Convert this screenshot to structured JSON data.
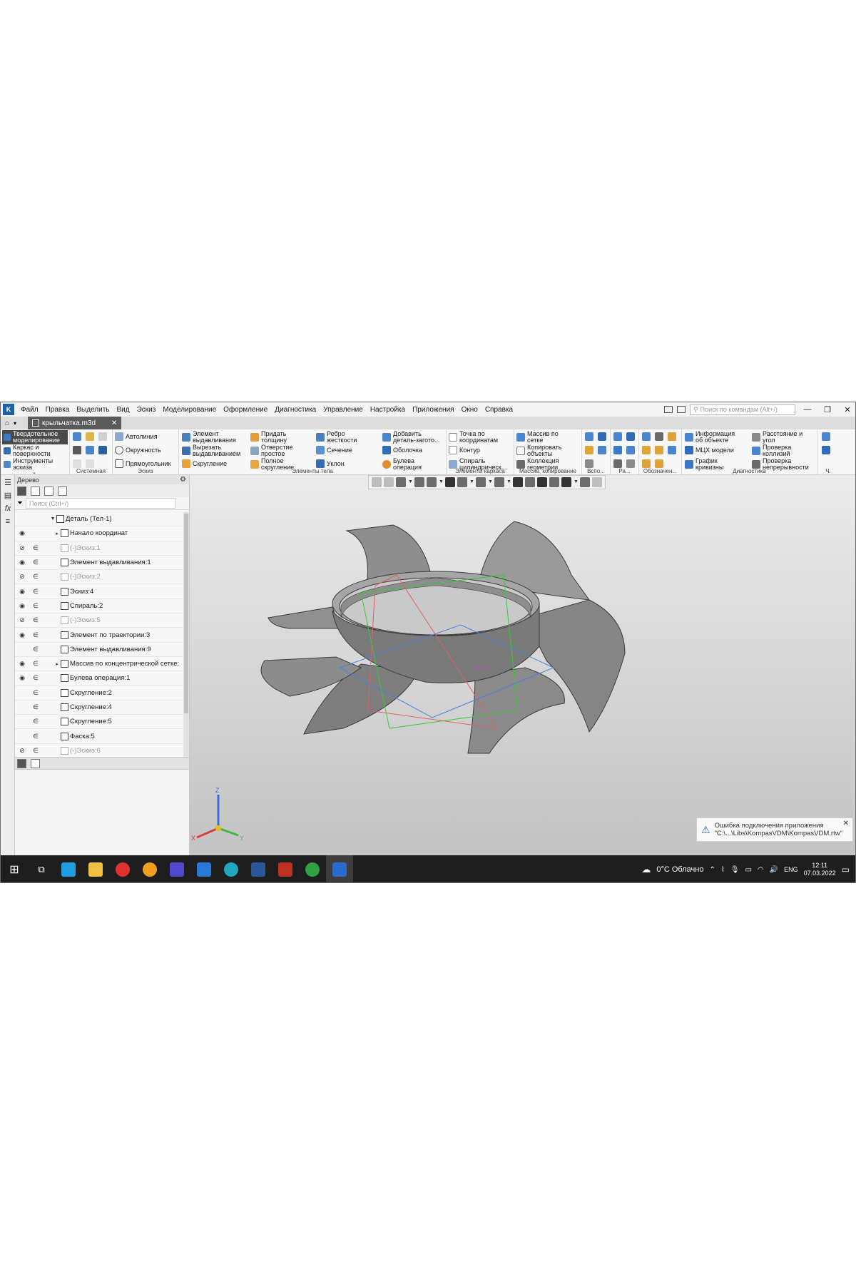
{
  "menu": {
    "items": [
      "Файл",
      "Правка",
      "Выделить",
      "Вид",
      "Эскиз",
      "Моделирование",
      "Оформление",
      "Диагностика",
      "Управление",
      "Настройка",
      "Приложения",
      "Окно",
      "Справка"
    ],
    "search_placeholder": "Поиск по командам (Alt+/)"
  },
  "tabs": {
    "document": "крыльчатка.m3d"
  },
  "ribbon": {
    "modes": [
      "Твердотельное\nмоделирование",
      "Каркас и\nповерхности",
      "Инструменты\nэскиза"
    ],
    "sketch_buttons": [
      "Автолиния",
      "Окружность",
      "Прямоугольник"
    ],
    "body_col1": [
      "Элемент\nвыдавливания",
      "Вырезать\nвыдавливанием",
      "Скругление"
    ],
    "body_col2": [
      "Придать\nтолщину",
      "Отверстие\nпростое",
      "Полное\nскругление"
    ],
    "body_col3": [
      "Ребро\nжесткости",
      "Сечение",
      "Уклон"
    ],
    "body_col4": [
      "Добавить\nдеталь-загото...",
      "Оболочка",
      "Булева\nоперация"
    ],
    "frame_buttons": [
      "Точка по\nкоординатам",
      "Контур",
      "Спираль\nцилиндрическ..."
    ],
    "array_buttons": [
      "Массив по\nсетке",
      "Копировать\nобъекты",
      "Коллекция\nгеометрии"
    ],
    "diag_col1": [
      "Информация\nоб объекте",
      "МЦХ модели",
      "График\nкривизны"
    ],
    "diag_col2": [
      "Расстояние и\nугол",
      "Проверка\nколлизий",
      "Проверка\nнепрерывности"
    ],
    "group_titles": {
      "system": "Системная",
      "sketch": "Эскиз",
      "body": "Элементы тела",
      "frame": "Элементы каркаса",
      "array": "Массив, копирование",
      "aux": "Вспо...",
      "ra": "Ра...",
      "marks": "Обозначен...",
      "diag": "Диагностика",
      "ch": "Ч."
    }
  },
  "tree": {
    "title": "Дерево",
    "search_placeholder": "Поиск (Ctrl+/)",
    "root": "Деталь (Тел-1)",
    "items": [
      {
        "label": "Начало координат",
        "eye": "◉",
        "cap": "",
        "dim": false,
        "expand": true
      },
      {
        "label": "(-)Эскиз:1",
        "eye": "⊘",
        "cap": "∈",
        "dim": true,
        "expand": false
      },
      {
        "label": "Элемент выдавливания:1",
        "eye": "◉",
        "cap": "∈",
        "dim": false,
        "expand": false
      },
      {
        "label": "(-)Эскиз:2",
        "eye": "⊘",
        "cap": "∈",
        "dim": true,
        "expand": false
      },
      {
        "label": "Эскиз:4",
        "eye": "◉",
        "cap": "∈",
        "dim": false,
        "expand": false
      },
      {
        "label": "Спираль:2",
        "eye": "◉",
        "cap": "∈",
        "dim": false,
        "expand": false
      },
      {
        "label": "(-)Эскиз:5",
        "eye": "⊘",
        "cap": "∈",
        "dim": true,
        "expand": false
      },
      {
        "label": "Элемент по траектории:3",
        "eye": "◉",
        "cap": "∈",
        "dim": false,
        "expand": false
      },
      {
        "label": "Элемент выдавливания:9",
        "eye": "",
        "cap": "∈",
        "dim": false,
        "expand": false
      },
      {
        "label": "Массив по концентрической сетке:",
        "eye": "◉",
        "cap": "∈",
        "dim": false,
        "expand": true
      },
      {
        "label": "Булева операция:1",
        "eye": "◉",
        "cap": "∈",
        "dim": false,
        "expand": false
      },
      {
        "label": "Скругление:2",
        "eye": "",
        "cap": "∈",
        "dim": false,
        "expand": false
      },
      {
        "label": "Скругление:4",
        "eye": "",
        "cap": "∈",
        "dim": false,
        "expand": false
      },
      {
        "label": "Скругление:5",
        "eye": "",
        "cap": "∈",
        "dim": false,
        "expand": false
      },
      {
        "label": "Фаска:5",
        "eye": "",
        "cap": "∈",
        "dim": false,
        "expand": false
      },
      {
        "label": "(-)Эскиз:6",
        "eye": "⊘",
        "cap": "∈",
        "dim": true,
        "expand": false
      }
    ]
  },
  "notification": {
    "line1": "Ошибка подключения приложения",
    "line2": "\"C:\\...\\Libs\\KompasVDM\\KompasVDM.rtw\""
  },
  "axes": {
    "x": "X",
    "y": "Y",
    "z": "Z"
  },
  "taskbar": {
    "weather": "0°C  Облачно",
    "lang": "ENG",
    "time": "12:11",
    "date": "07.03.2022"
  },
  "colors": {
    "brand": "#1e5fa8",
    "active_mode": "#4a4a4a",
    "taskbar": "#1e1e1e",
    "model_grey": "#8e8e8e",
    "plane_green": "#33cc33",
    "plane_red": "#e06060",
    "plane_blue": "#4a7fe0"
  }
}
